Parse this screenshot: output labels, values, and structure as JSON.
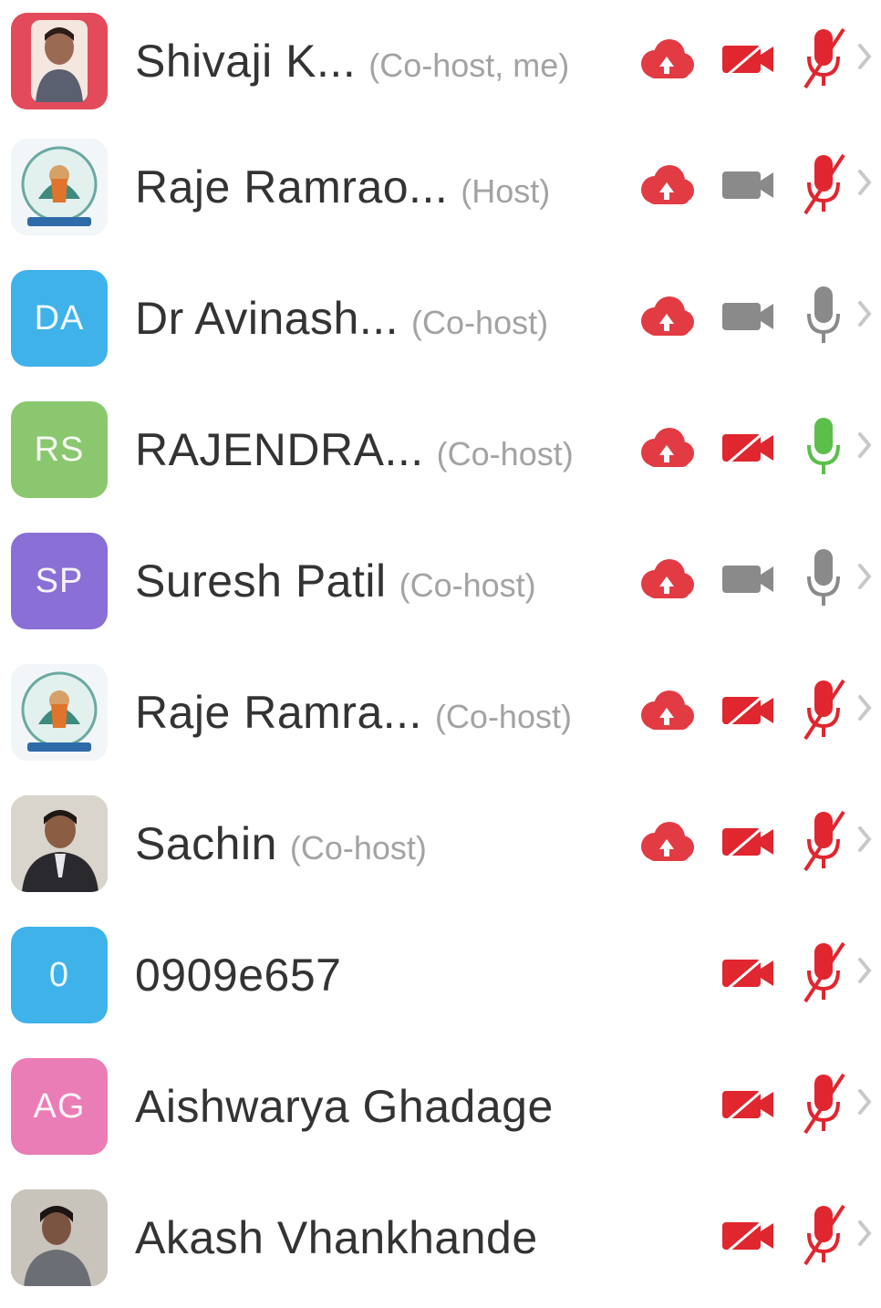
{
  "participants": [
    {
      "name": "Shivaji K...",
      "role": "(Co-host, me)",
      "avatar": {
        "type": "photo",
        "bg": "#e34b5a"
      },
      "cloud": true,
      "video_color": "#e0262f",
      "mic": "muted"
    },
    {
      "name": "Raje Ramrao...",
      "role": "(Host)",
      "avatar": {
        "type": "logo",
        "bg": "#f3f6f8"
      },
      "cloud": true,
      "video_color": "#8a8a8a",
      "mic": "muted"
    },
    {
      "name": "Dr Avinash...",
      "role": "(Co-host)",
      "avatar": {
        "type": "initials",
        "text": "DA",
        "bg": "#3fb2ea"
      },
      "cloud": true,
      "video_color": "#8a8a8a",
      "mic": "idle"
    },
    {
      "name": "RAJENDRA...",
      "role": "(Co-host)",
      "avatar": {
        "type": "initials",
        "text": "RS",
        "bg": "#8bc76e"
      },
      "cloud": true,
      "video_color": "#e0262f",
      "mic": "speaking"
    },
    {
      "name": "Suresh Patil",
      "role": "(Co-host)",
      "avatar": {
        "type": "initials",
        "text": "SP",
        "bg": "#8a6fd6"
      },
      "cloud": true,
      "video_color": "#8a8a8a",
      "mic": "idle"
    },
    {
      "name": "Raje Ramra...",
      "role": "(Co-host)",
      "avatar": {
        "type": "logo",
        "bg": "#f3f6f8"
      },
      "cloud": true,
      "video_color": "#e0262f",
      "mic": "muted"
    },
    {
      "name": "Sachin",
      "role": "(Co-host)",
      "avatar": {
        "type": "photo",
        "bg": "#c9c4bc"
      },
      "cloud": true,
      "video_color": "#e0262f",
      "mic": "muted"
    },
    {
      "name": "0909e657",
      "role": "",
      "avatar": {
        "type": "initials",
        "text": "0",
        "bg": "#3fb2ea"
      },
      "cloud": false,
      "video_color": "#e0262f",
      "mic": "muted"
    },
    {
      "name": "Aishwarya Ghadage",
      "role": "",
      "avatar": {
        "type": "initials",
        "text": "AG",
        "bg": "#ea7db5"
      },
      "cloud": false,
      "video_color": "#e0262f",
      "mic": "muted"
    },
    {
      "name": "Akash Vhankhande",
      "role": "",
      "avatar": {
        "type": "photo",
        "bg": "#b9b4ab"
      },
      "cloud": false,
      "video_color": "#e0262f",
      "mic": "muted"
    }
  ],
  "colors": {
    "muted_red": "#e0262f",
    "idle_gray": "#8a8a8a",
    "speaking_green": "#5cbf4a",
    "cloud_red": "#e23b44",
    "chevron": "#c8c8c8"
  },
  "icon_names": {
    "cloud": "cloud-record-icon",
    "video": "video-camera-icon",
    "mic": "microphone-icon",
    "chevron": "chevron-right-icon"
  }
}
